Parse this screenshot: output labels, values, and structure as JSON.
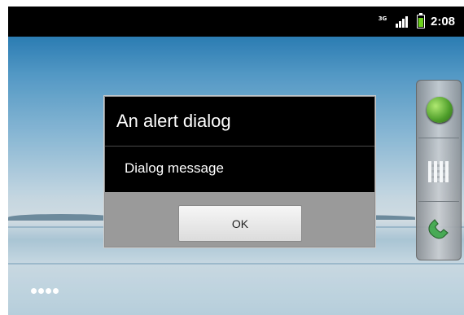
{
  "status_bar": {
    "network_label": "3G",
    "time": "2:08",
    "icons": [
      "network-3g-icon",
      "signal-strength-icon",
      "battery-charging-icon"
    ],
    "battery_color": "#6dd11c"
  },
  "dialog": {
    "title": "An alert dialog",
    "message": "Dialog message",
    "ok_label": "OK"
  },
  "dock": {
    "icons": [
      "browser-globe-icon",
      "app-launcher-icon",
      "phone-dialer-icon"
    ]
  },
  "home_indicator": {
    "pages": 4
  }
}
